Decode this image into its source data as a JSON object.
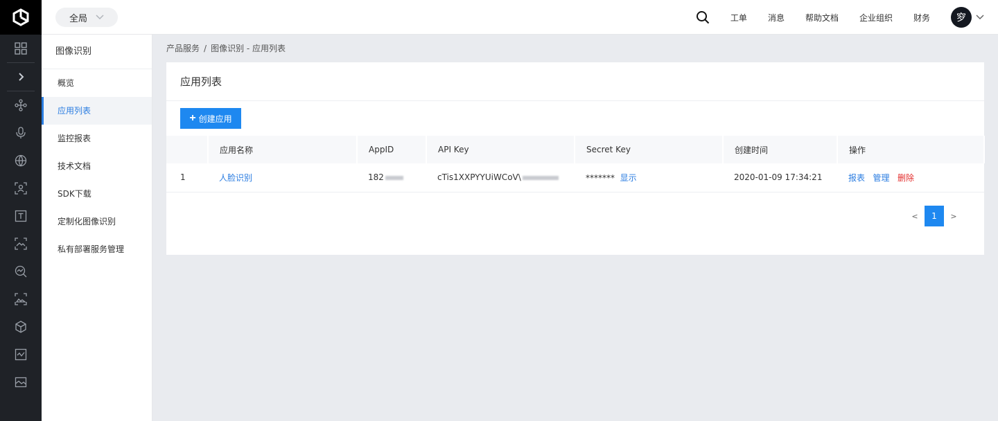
{
  "topbar": {
    "scope_label": "全局",
    "nav": [
      "工单",
      "消息",
      "帮助文档",
      "企业组织",
      "财务"
    ],
    "avatar_text": "穸"
  },
  "rail_icons": [
    "logo-icon",
    "dashboard-grid-icon",
    "expand-chevron-icon",
    "network-nodes-icon",
    "microphone-icon",
    "globe-icon",
    "face-scan-icon",
    "text-recognition-icon",
    "image-recognition-icon",
    "data-insight-icon",
    "image-scan-icon",
    "cube-icon",
    "chart-image-icon",
    "picture-icon"
  ],
  "submenu": {
    "title": "图像识别",
    "items": [
      "概览",
      "应用列表",
      "监控报表",
      "技术文档",
      "SDK下载",
      "定制化图像识别",
      "私有部署服务管理"
    ],
    "active_index": 1
  },
  "breadcrumb": {
    "root": "产品服务",
    "separator": "/",
    "current": "图像识别 - 应用列表"
  },
  "panel": {
    "title": "应用列表",
    "create_label": "创建应用"
  },
  "table": {
    "headers": [
      "",
      "应用名称",
      "AppID",
      "API Key",
      "Secret Key",
      "创建时间",
      "操作"
    ],
    "rows": [
      {
        "index": "1",
        "name": "人脸识别",
        "app_id": "182",
        "api_key": "cTis1XXPYYUiWCoV\\",
        "secret_key": "*******",
        "show_label": "显示",
        "created": "2020-01-09 17:34:21",
        "actions": [
          "报表",
          "管理",
          "删除"
        ]
      }
    ]
  },
  "pager": {
    "prev": "<",
    "current": "1",
    "next": ">"
  },
  "colors": {
    "accent": "#1e88f0",
    "link": "#2b7de1",
    "danger": "#e3302f",
    "rail": "#1f2227"
  }
}
